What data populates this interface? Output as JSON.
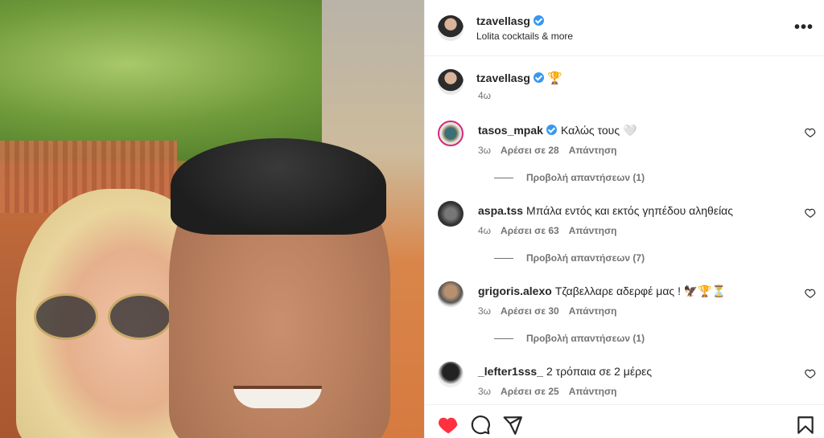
{
  "post": {
    "author": "tzavellasg",
    "subtitle": "Lolita cocktails & more",
    "more_label": "•••",
    "caption_time": "4ω",
    "caption_emoji": "🏆",
    "liked": true
  },
  "comments": [
    {
      "user": "tasos_mpak",
      "verified": true,
      "text": "Καλώς τους 🤍",
      "time": "3ω",
      "likes": "Αρέσει σε 28",
      "reply": "Απάντηση",
      "view_replies": "Προβολή απαντήσεων (1)"
    },
    {
      "user": "aspa.tss",
      "text": "Μπάλα εντός και εκτός γηπέδου αληθείας",
      "time": "4ω",
      "likes": "Αρέσει σε 63",
      "reply": "Απάντηση",
      "view_replies": "Προβολή απαντήσεων (7)"
    },
    {
      "user": "grigoris.alexo",
      "text": "Τζαβελλαρε αδερφέ μας ! 🦅🏆⏳",
      "time": "3ω",
      "likes": "Αρέσει σε 30",
      "reply": "Απάντηση",
      "view_replies": "Προβολή απαντήσεων (1)"
    },
    {
      "user": "_lefter1sss_",
      "text": "2 τρόπαια σε 2 μέρες",
      "time": "3ω",
      "likes": "Αρέσει σε 25",
      "reply": "Απάντηση"
    }
  ],
  "colors": {
    "like_red": "#ff3040",
    "verified_blue": "#3897f0",
    "muted": "#737373"
  },
  "icons": [
    "heart-icon",
    "comment-icon",
    "share-icon",
    "bookmark-icon",
    "more-icon",
    "verified-icon"
  ]
}
